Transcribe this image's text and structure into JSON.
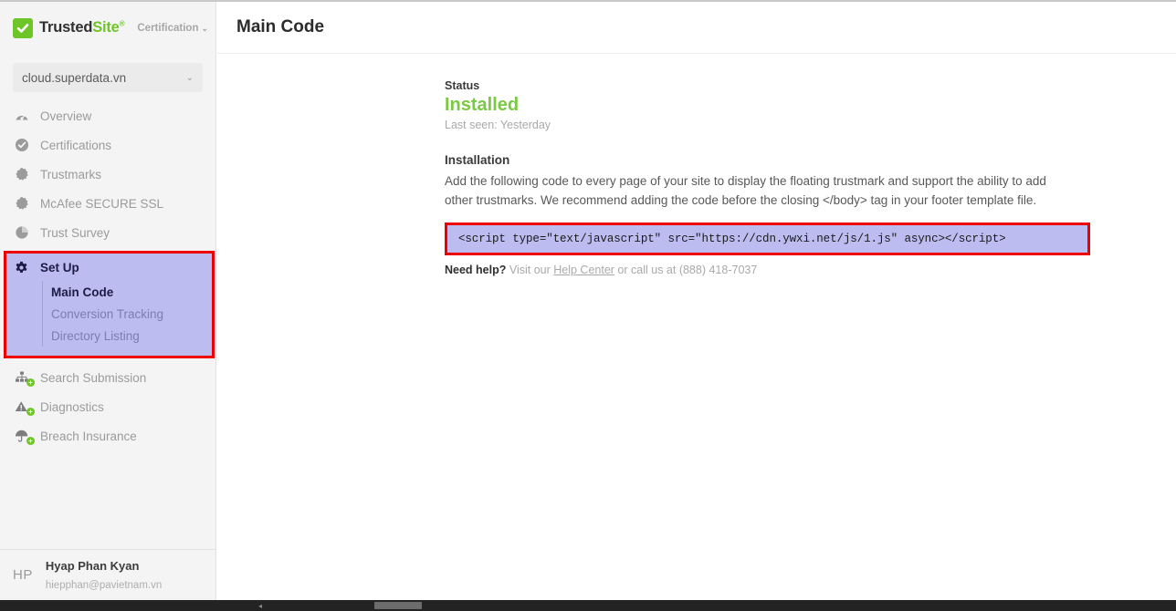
{
  "brand": {
    "check_icon": "check-icon",
    "name_part1": "Trusted",
    "name_part2": "Site",
    "registered": "®",
    "section": "Certification",
    "caret": "⌄",
    "accent_green": "#6ec528"
  },
  "sidebar": {
    "domain_selector": {
      "value": "cloud.superdata.vn",
      "caret": "⌄"
    },
    "items_upper": [
      {
        "label": "Overview",
        "icon": "speedometer-icon",
        "badge": ""
      },
      {
        "label": "Certifications",
        "icon": "check-circle-icon",
        "badge": ""
      },
      {
        "label": "Trustmarks",
        "icon": "seal-badge-icon",
        "badge": ""
      },
      {
        "label": "McAfee SECURE SSL",
        "icon": "seal-badge-icon",
        "badge": ""
      },
      {
        "label": "Trust Survey",
        "icon": "pie-chart-icon",
        "badge": ""
      }
    ],
    "setup": {
      "label": "Set Up",
      "icon": "gear-icon",
      "highlight_bg": "#bcbcf0",
      "highlight_border": "#ee0000",
      "subitems": [
        {
          "label": "Main Code",
          "active": true
        },
        {
          "label": "Conversion Tracking",
          "active": false
        },
        {
          "label": "Directory Listing",
          "active": false
        }
      ]
    },
    "items_lower": [
      {
        "label": "Search Submission",
        "icon": "sitemap-icon",
        "badge": "+"
      },
      {
        "label": "Diagnostics",
        "icon": "warning-triangle-icon",
        "badge": "+"
      },
      {
        "label": "Breach Insurance",
        "icon": "umbrella-icon",
        "badge": "+"
      }
    ],
    "user": {
      "initials": "HP",
      "name": "Hyap Phan Kyan",
      "email": "hiepphan@pavietnam.vn"
    }
  },
  "main": {
    "page_title": "Main Code",
    "status": {
      "label": "Status",
      "value": "Installed",
      "value_color": "#7ac943",
      "last_seen": "Last seen: Yesterday"
    },
    "installation": {
      "heading": "Installation",
      "description": "Add the following code to every page of your site to display the floating trustmark and support the ability to add other trustmarks. We recommend adding the code before the closing </body> tag in your footer template file.",
      "code": "<script type=\"text/javascript\" src=\"https://cdn.ywxi.net/js/1.js\" async></scr"
    },
    "help": {
      "strong": "Need help?",
      "before_link": " Visit our ",
      "link": "Help Center",
      "after_link": " or call us at (888) 418-7037"
    }
  },
  "scrollbar": {
    "arrow": "◂"
  }
}
